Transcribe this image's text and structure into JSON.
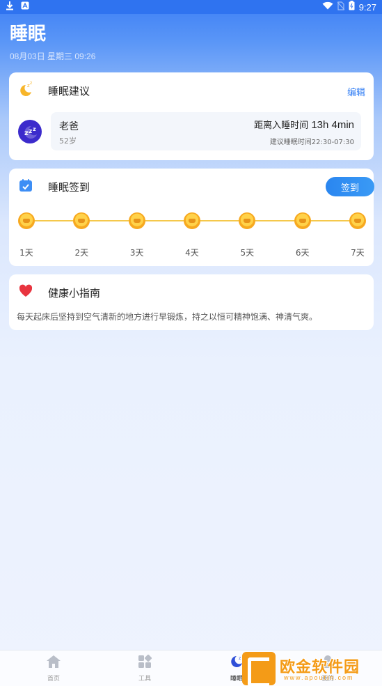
{
  "status_bar": {
    "time": "9:27"
  },
  "page": {
    "title": "睡眠",
    "date": "08月03日 星期三 09:26"
  },
  "sleep_advice": {
    "title": "睡眠建议",
    "edit_label": "编辑",
    "person_name": "老爸",
    "person_age": "52岁",
    "distance_label": "距离入睡时间",
    "distance_hours": "13h",
    "distance_minutes": "4min",
    "suggested": "建议睡眠时间22:30-07:30"
  },
  "sleep_signin": {
    "title": "睡眠签到",
    "button_label": "签到",
    "days": [
      "1天",
      "2天",
      "3天",
      "4天",
      "5天",
      "6天",
      "7天"
    ]
  },
  "health_tip": {
    "title": "健康小指南",
    "text": "每天起床后坚持到空气清新的地方进行早锻炼，持之以恒可精神饱满、神清气爽。"
  },
  "bottom_nav": {
    "tabs": [
      {
        "label": "首页",
        "icon": "home-icon"
      },
      {
        "label": "工具",
        "icon": "tools-icon"
      },
      {
        "label": "睡眠",
        "icon": "moon-icon"
      },
      {
        "label": "我的",
        "icon": "user-icon"
      }
    ],
    "active_index": 2
  },
  "watermark": {
    "text": "欧金软件园",
    "url": "www.apoutin.com"
  },
  "colors": {
    "accent": "#2f7cf4",
    "coin": "#f7a920",
    "heart": "#e8343f"
  }
}
